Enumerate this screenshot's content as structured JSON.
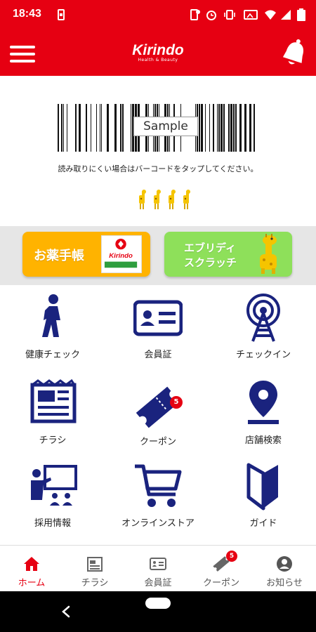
{
  "status_bar": {
    "time": "18:43"
  },
  "header": {
    "brand": "Kirindo",
    "tagline": "Health & Beauty"
  },
  "barcode": {
    "sample_label": "Sample",
    "hint": "読み取りにくい場合はバーコードをタップしてください。"
  },
  "banners": {
    "left": {
      "label": "お薬手帳",
      "image_text": "Kirindo"
    },
    "right": {
      "line1": "エブリディ",
      "line2": "スクラッチ"
    }
  },
  "menu": {
    "health_check": "健康チェック",
    "member_card": "会員証",
    "check_in": "チェックイン",
    "flyer": "チラシ",
    "coupon": "クーポン",
    "coupon_badge": "5",
    "store_search": "店舗検索",
    "recruit": "採用情報",
    "online_store": "オンラインストア",
    "guide": "ガイド"
  },
  "bottom_nav": {
    "home": "ホーム",
    "flyer": "チラシ",
    "member_card": "会員証",
    "coupon": "クーポン",
    "coupon_badge": "5",
    "notice": "お知らせ",
    "active_item": "home"
  },
  "colors": {
    "brand_red": "#e60012",
    "icon_navy": "#1a237e",
    "banner_orange": "#ffb300",
    "banner_green": "#8ee05a"
  }
}
